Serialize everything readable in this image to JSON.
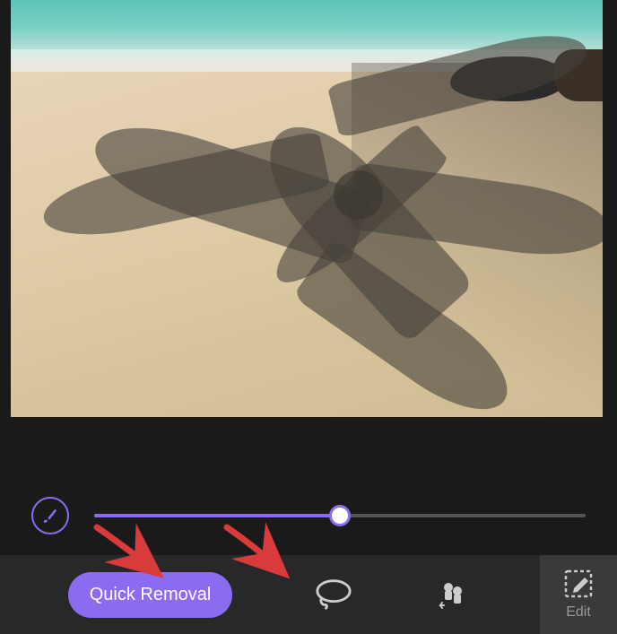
{
  "brush": {
    "slider_percent": 50
  },
  "toolbar": {
    "quick_removal_label": "Quick Removal",
    "edit_label": "Edit"
  },
  "icons": {
    "brush": "brush-icon",
    "lasso": "lasso-icon",
    "clone_stamp": "clone-stamp-icon",
    "edit_crop": "edit-crop-icon"
  },
  "colors": {
    "accent": "#8b6cf0",
    "toolbar_bg": "#282828",
    "edit_bg": "#3a3a3a",
    "arrow": "#d93a3a"
  }
}
